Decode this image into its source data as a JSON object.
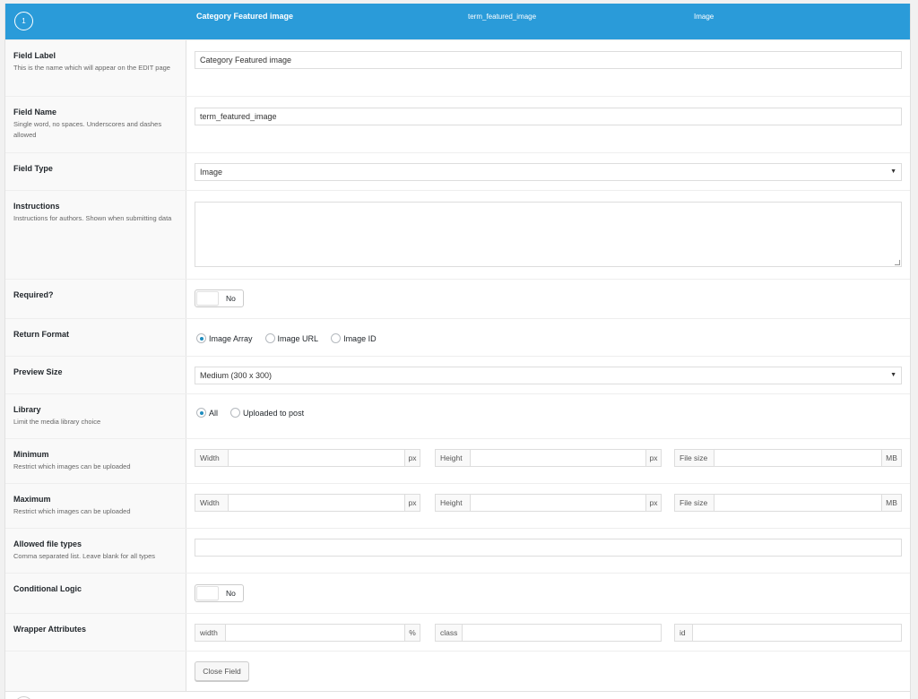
{
  "header": {
    "order": "1",
    "label": "Category Featured image",
    "name": "term_featured_image",
    "type": "Image"
  },
  "fields": {
    "label": {
      "title": "Field Label",
      "desc": "This is the name which will appear on the EDIT page",
      "value": "Category Featured image"
    },
    "name": {
      "title": "Field Name",
      "desc": "Single word, no spaces. Underscores and dashes allowed",
      "value": "term_featured_image"
    },
    "type": {
      "title": "Field Type",
      "value": "Image"
    },
    "instructions": {
      "title": "Instructions",
      "desc": "Instructions for authors. Shown when submitting data",
      "value": ""
    },
    "required": {
      "title": "Required?",
      "toggle": "No"
    },
    "return_format": {
      "title": "Return Format",
      "options": [
        "Image Array",
        "Image URL",
        "Image ID"
      ],
      "selected": "Image Array"
    },
    "preview_size": {
      "title": "Preview Size",
      "value": "Medium (300 x 300)"
    },
    "library": {
      "title": "Library",
      "desc": "Limit the media library choice",
      "options": [
        "All",
        "Uploaded to post"
      ],
      "selected": "All"
    },
    "minimum": {
      "title": "Minimum",
      "desc": "Restrict which images can be uploaded",
      "width": "Width",
      "height": "Height",
      "filesize": "File size",
      "px": "px",
      "mb": "MB"
    },
    "maximum": {
      "title": "Maximum",
      "desc": "Restrict which images can be uploaded",
      "width": "Width",
      "height": "Height",
      "filesize": "File size",
      "px": "px",
      "mb": "MB"
    },
    "allowed_types": {
      "title": "Allowed file types",
      "desc": "Comma separated list. Leave blank for all types",
      "value": ""
    },
    "conditional": {
      "title": "Conditional Logic",
      "toggle": "No"
    },
    "wrapper": {
      "title": "Wrapper Attributes",
      "width": "width",
      "percent": "%",
      "class": "class",
      "id": "id"
    }
  },
  "close_button": "Close Field",
  "colors": {
    "header_bg": "#2a9bd9",
    "radio_dot": "#1e8cbe"
  }
}
